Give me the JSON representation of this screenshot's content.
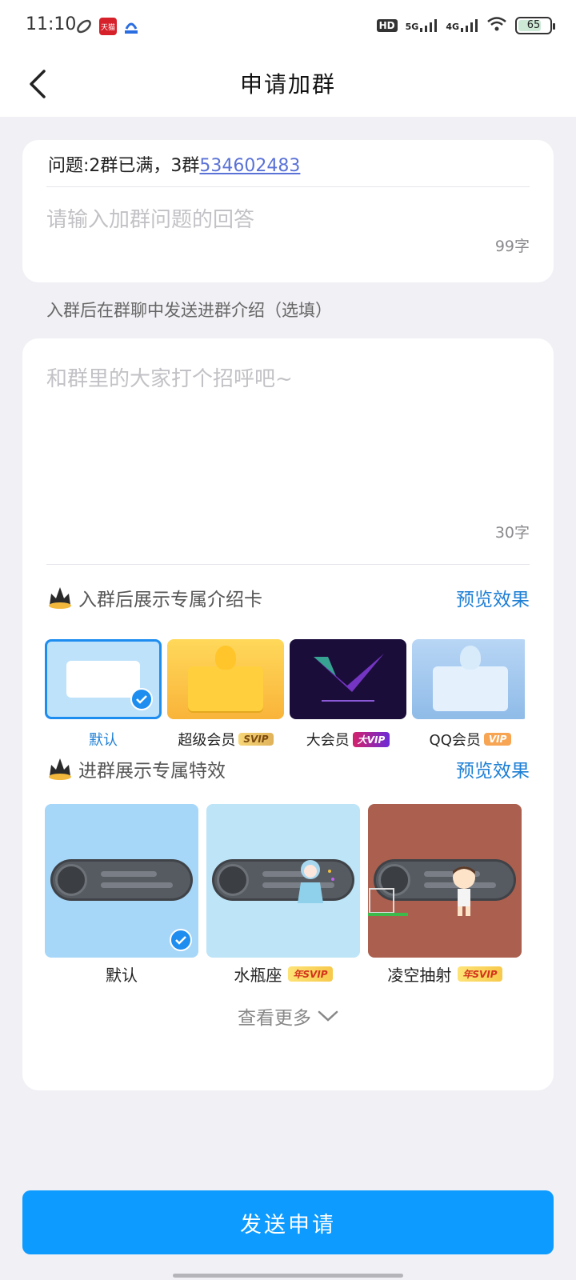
{
  "status": {
    "time": "11:10",
    "network_1": "5G",
    "network_2": "4G",
    "hd_label": "HD",
    "battery": "65",
    "app_icons": [
      "link-icon",
      "tmall-icon",
      "baidu-icon"
    ]
  },
  "nav": {
    "title": "申请加群"
  },
  "question": {
    "prefix": "问题:2群已满，3群",
    "link": "534602483",
    "answer_placeholder": "请输入加群问题的回答",
    "answer_counter": "99字"
  },
  "intro_hint": "入群后在群聊中发送进群介绍（选填）",
  "intro": {
    "placeholder": "和群里的大家打个招呼吧~",
    "counter": "30字"
  },
  "intro_card_section": {
    "title": "入群后展示专属介绍卡",
    "preview": "预览效果",
    "cards": [
      {
        "label": "默认",
        "badge": "",
        "selected": true
      },
      {
        "label": "超级会员",
        "badge": "SVIP",
        "selected": false
      },
      {
        "label": "大会员",
        "badge": "大VIP",
        "selected": false
      },
      {
        "label": "QQ会员",
        "badge": "VIP",
        "selected": false
      }
    ]
  },
  "effect_section": {
    "title": "进群展示专属特效",
    "preview": "预览效果",
    "effects": [
      {
        "label": "默认",
        "badge": "",
        "selected": true
      },
      {
        "label": "水瓶座",
        "badge": "年SVIP",
        "selected": false
      },
      {
        "label": "凌空抽射",
        "badge": "年SVIP",
        "selected": false
      }
    ],
    "more": "查看更多"
  },
  "send_button": "发送申请",
  "colors": {
    "accent": "#0d9bff",
    "link": "#5a72d6",
    "preview_text": "#1e7fd4"
  }
}
